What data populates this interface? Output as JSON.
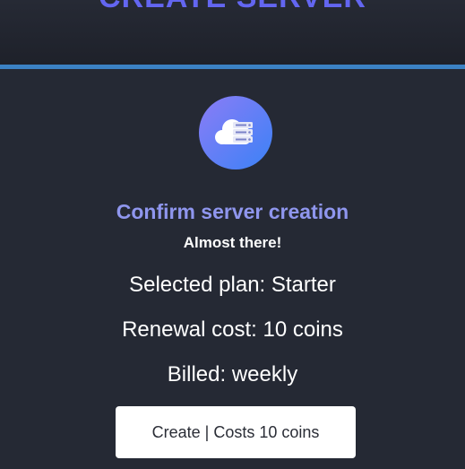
{
  "header": {
    "title": "CREATE SERVER"
  },
  "colors": {
    "title": "#6366f1",
    "accent_bar": "#3b82c4",
    "confirm_title": "#8f96ee",
    "background": "#232731",
    "button_bg": "#ffffff"
  },
  "icon": {
    "name": "cloud-server-icon"
  },
  "confirm": {
    "title": "Confirm server creation",
    "subtitle": "Almost there!",
    "plan": "Selected plan: Starter",
    "renewal": "Renewal cost: 10 coins",
    "billed": "Billed: weekly"
  },
  "actions": {
    "create_label": "Create | Costs 10 coins"
  }
}
